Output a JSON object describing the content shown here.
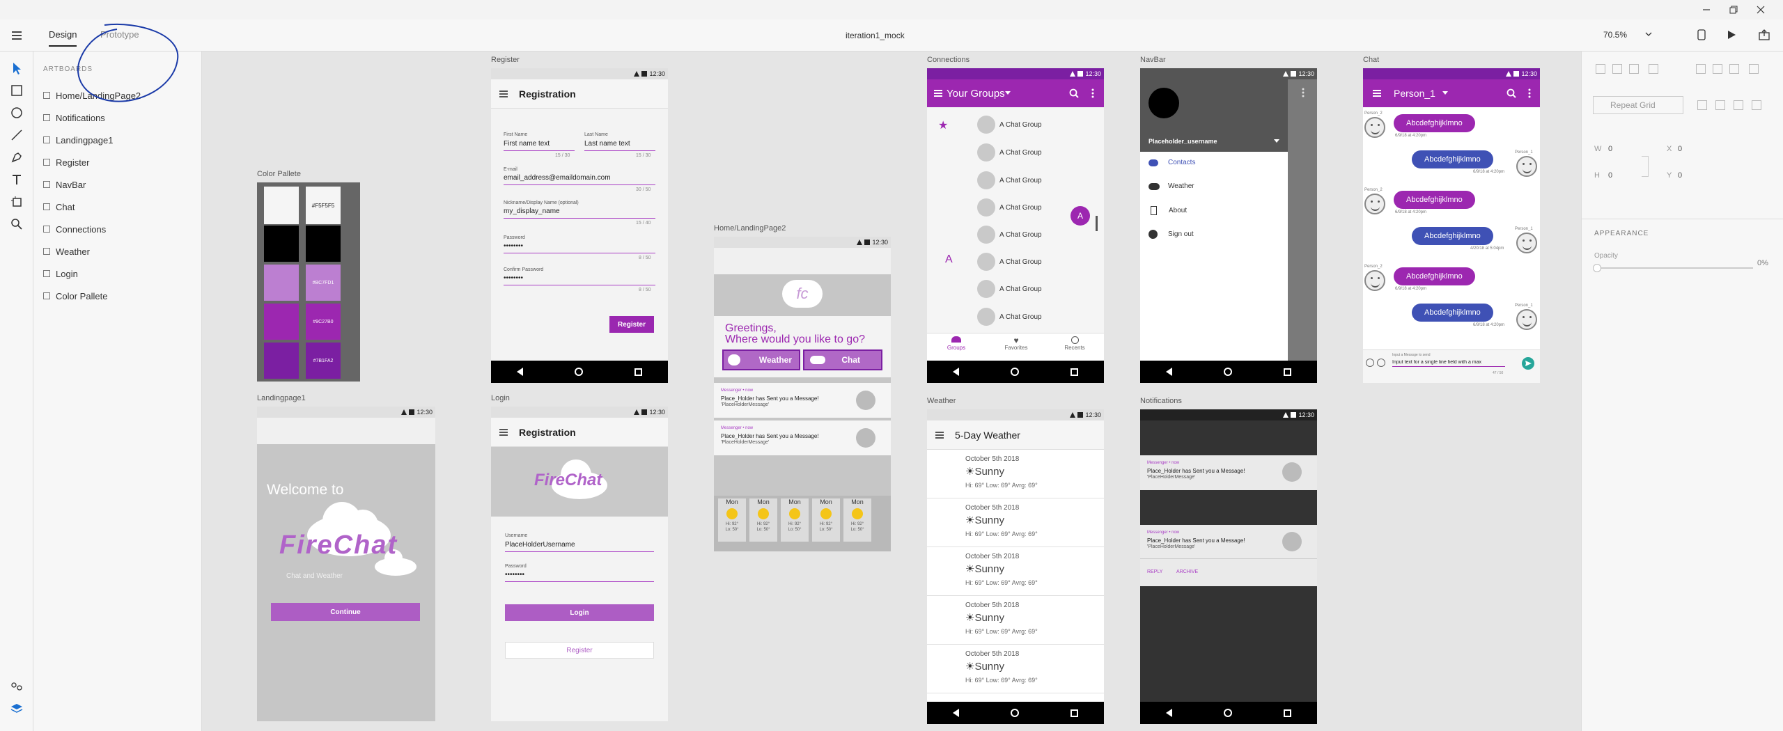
{
  "window": {
    "doc_title": "iteration1_mock",
    "zoom": "70.5%"
  },
  "tabs": [
    {
      "label": "Design"
    },
    {
      "label": "Prototype"
    }
  ],
  "layers": {
    "header": "ARTBOARDS",
    "items": [
      "Home/LandingPage2",
      "Notifications",
      "Landingpage1",
      "Register",
      "NavBar",
      "Chat",
      "Connections",
      "Weather",
      "Login",
      "Color Pallete"
    ]
  },
  "inspector": {
    "repeat_grid": "Repeat Grid",
    "w_label": "W",
    "w_value": "0",
    "x_label": "X",
    "x_value": "0",
    "h_label": "H",
    "h_value": "0",
    "y_label": "Y",
    "y_value": "0",
    "appearance": "APPEARANCE",
    "opacity_label": "Opacity",
    "opacity_value": "0%"
  },
  "artboards": {
    "color_pallete": {
      "label": "Color Pallete",
      "swatches": [
        {
          "color": "#F5F5F5",
          "hex": "#F5F5F5"
        },
        {
          "color": "#000000",
          "hex": ""
        },
        {
          "color": "#BC7FD1",
          "hex": "#BC7FD1"
        },
        {
          "color": "#9C27B0",
          "hex": "#9C27B0"
        },
        {
          "color": "#7B1FA2",
          "hex": "#7B1FA2"
        }
      ]
    },
    "register": {
      "label": "Register",
      "time": "12:30",
      "title": "Registration",
      "first_name_label": "First Name",
      "first_name_value": "First name text",
      "first_name_count": "15 / 30",
      "last_name_label": "Last Name",
      "last_name_value": "Last name text",
      "last_name_count": "15 / 30",
      "email_label": "E-mail",
      "email_value": "email_address@emaildomain.com",
      "email_count": "30 / 50",
      "nickname_label": "Nickname/Display Name (optional)",
      "nickname_value": "my_display_name",
      "nickname_count": "15 / 40",
      "password_label": "Password",
      "password_value": "••••••••",
      "password_count": "8 / 50",
      "confirm_label": "Confirm Password",
      "confirm_value": "••••••••",
      "confirm_count": "8 / 50",
      "button": "Register"
    },
    "landing1": {
      "label": "Landingpage1",
      "time": "12:30",
      "welcome": "Welcome to",
      "logo": "FireChat",
      "subtitle": "Chat and Weather",
      "button": "Continue"
    },
    "login": {
      "label": "Login",
      "time": "12:30",
      "title": "Registration",
      "logo": "FireChat",
      "username_label": "Username",
      "username_value": "PlaceHolderUsername",
      "password_label": "Password",
      "password_value": "••••••••",
      "login_button": "Login",
      "register_button": "Register"
    },
    "home": {
      "label": "Home/LandingPage2",
      "time": "12:30",
      "logo": "fc",
      "greeting1": "Greetings,",
      "greeting2": "Where would you like to go?",
      "weather_button": "Weather",
      "chat_button": "Chat",
      "notifications": [
        {
          "app": "Messenger • now",
          "title": "Place_Holder has Sent you a Message!",
          "body": "'PlaceHolderMessage'"
        },
        {
          "app": "Messenger • now",
          "title": "Place_Holder has Sent you a Message!",
          "body": "'PlaceHolderMessage'"
        }
      ],
      "forecast": [
        {
          "day": "Mon",
          "hi": "Hi: 92°",
          "lo": "Lo: 50°"
        },
        {
          "day": "Mon",
          "hi": "Hi: 92°",
          "lo": "Lo: 50°"
        },
        {
          "day": "Mon",
          "hi": "Hi: 92°",
          "lo": "Lo: 50°"
        },
        {
          "day": "Mon",
          "hi": "Hi: 92°",
          "lo": "Lo: 50°"
        },
        {
          "day": "Mon",
          "hi": "Hi: 92°",
          "lo": "Lo: 50°"
        }
      ]
    },
    "connections": {
      "label": "Connections",
      "time": "12:30",
      "title": "Your Groups",
      "groups": [
        "A Chat Group",
        "A Chat Group",
        "A Chat Group",
        "A Chat Group",
        "A Chat Group",
        "A Chat Group",
        "A Chat Group",
        "A Chat Group"
      ],
      "fab_letter": "A",
      "index_letter": "A",
      "bottom_tabs": [
        "Groups",
        "Favorites",
        "Recents"
      ]
    },
    "navbar": {
      "label": "NavBar",
      "time": "12:30",
      "username": "Placeholder_username",
      "items": [
        "Contacts",
        "Weather",
        "About",
        "Sign out"
      ]
    },
    "chat": {
      "label": "Chat",
      "time": "12:30",
      "title": "Person_1",
      "messages": [
        {
          "who": "Person_2",
          "text": "Abcdefghijklmno",
          "time": "6/9/18 at 4:20pm",
          "side": "left"
        },
        {
          "who": "Person_1",
          "text": "Abcdefghijklmno",
          "time": "6/9/18 at 4:20pm",
          "side": "right"
        },
        {
          "who": "Person_2",
          "text": "Abcdefghijklmno",
          "time": "6/9/18 at 4:20pm",
          "side": "left"
        },
        {
          "who": "Person_1",
          "text": "Abcdefghijklmno",
          "time": "4/20/18 at 5:04pm",
          "side": "right"
        },
        {
          "who": "Person_2",
          "text": "Abcdefghijklmno",
          "time": "6/9/18 at 4:20pm",
          "side": "left"
        },
        {
          "who": "Person_1",
          "text": "Abcdefghijklmno",
          "time": "6/9/18 at 4:20pm",
          "side": "right"
        }
      ],
      "input_hint": "Input a Messsge to send",
      "input_value": "Input text for a single line field with a max",
      "input_count": "47 / 50"
    },
    "weather": {
      "label": "Weather",
      "time": "12:30",
      "title": "5-Day Weather",
      "days": [
        {
          "date": "October 5th 2018",
          "cond": "Sunny",
          "temps": "Hi: 69°    Low: 69°    Avrg: 69°"
        },
        {
          "date": "October 5th 2018",
          "cond": "Sunny",
          "temps": "Hi: 69°    Low: 69°    Avrg: 69°"
        },
        {
          "date": "October 5th 2018",
          "cond": "Sunny",
          "temps": "Hi: 69°    Low: 69°    Avrg: 69°"
        },
        {
          "date": "October 5th 2018",
          "cond": "Sunny",
          "temps": "Hi: 69°    Low: 69°    Avrg: 69°"
        },
        {
          "date": "October 5th 2018",
          "cond": "Sunny",
          "temps": "Hi: 69°    Low: 69°    Avrg: 69°"
        }
      ]
    },
    "notifications": {
      "label": "Notifications",
      "time": "12:30",
      "items": [
        {
          "app": "Messenger • now",
          "title": "Place_Holder has Sent you a Message!",
          "body": "'PlaceHolderMessage'"
        },
        {
          "app": "Messenger • now",
          "title": "Place_Holder has Sent you a Message!",
          "body": "'PlaceHolderMessage'"
        }
      ],
      "reply": "REPLY",
      "archive": "ARCHIVE"
    }
  },
  "colors": {
    "purple": "#9C27B0",
    "purple_dark": "#7B1FA2",
    "purple_light": "#BC7FD1",
    "blue_bubble": "#3f51b5",
    "ink_annotation": "#1a3aa8"
  }
}
